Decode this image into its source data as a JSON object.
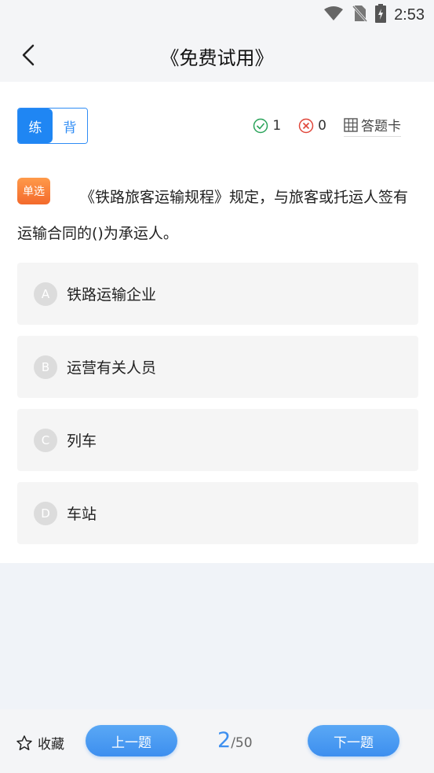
{
  "status": {
    "time": "2:53"
  },
  "header": {
    "title": "《免费试用》"
  },
  "mode": {
    "practice": "练",
    "recite": "背"
  },
  "stats": {
    "correct": "1",
    "wrong": "0",
    "answer_card": "答题卡"
  },
  "question": {
    "type_badge": "单选",
    "text": "《铁路旅客运输规程》规定，与旅客或托运人签有运输合同的()为承运人。"
  },
  "options": [
    {
      "letter": "A",
      "text": "铁路运输企业"
    },
    {
      "letter": "B",
      "text": "运营有关人员"
    },
    {
      "letter": "C",
      "text": "列车"
    },
    {
      "letter": "D",
      "text": "车站"
    }
  ],
  "footer": {
    "favorite": "收藏",
    "prev": "上一题",
    "next": "下一题",
    "current": "2",
    "total": "/50"
  },
  "colors": {
    "accent": "#1f86f3",
    "badge": "#f36a2c",
    "correct": "#2aa35a",
    "wrong": "#e0463a"
  }
}
